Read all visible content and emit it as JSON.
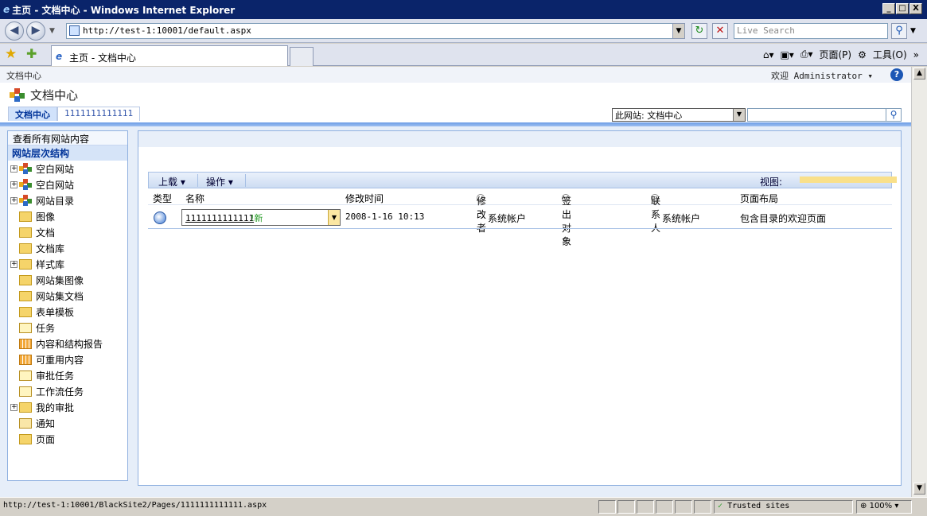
{
  "window": {
    "title": "主页 - 文档中心 - Windows Internet Explorer",
    "minimize": "_",
    "maximize": "□",
    "close": "X"
  },
  "browser": {
    "url": "http://test-1:10001/default.aspx",
    "search_placeholder": "Live Search",
    "tab_title": "主页 - 文档中心",
    "page_menu": "页面(P)",
    "tools_menu": "工具(O)",
    "more": "»"
  },
  "topbar": {
    "breadcrumb": "文档中心",
    "welcome": "欢迎 Administrator ▾",
    "help": "?"
  },
  "site": {
    "title": "文档中心",
    "tabs": [
      "文档中心",
      "1111111111111"
    ],
    "scope_selected": "此网站: 文档中心"
  },
  "leftnav": {
    "view_all": "查看所有网站内容",
    "hierarchy": "网站层次结构",
    "items": [
      {
        "label": "空白网站",
        "icon": "site-icon",
        "expandable": true
      },
      {
        "label": "空白网站",
        "icon": "site-icon",
        "expandable": true
      },
      {
        "label": "网站目录",
        "icon": "site-icon",
        "expandable": true
      },
      {
        "label": "图像",
        "icon": "folder-icon",
        "expandable": false
      },
      {
        "label": "文档",
        "icon": "folder-icon",
        "expandable": false
      },
      {
        "label": "文档库",
        "icon": "folder-icon",
        "expandable": false
      },
      {
        "label": "样式库",
        "icon": "folder-icon",
        "expandable": true
      },
      {
        "label": "网站集图像",
        "icon": "folder-icon",
        "expandable": false
      },
      {
        "label": "网站集文档",
        "icon": "folder-icon",
        "expandable": false
      },
      {
        "label": "表单模板",
        "icon": "folder-icon",
        "expandable": false
      },
      {
        "label": "任务",
        "icon": "task-icon",
        "expandable": false
      },
      {
        "label": "内容和结构报告",
        "icon": "report-icon",
        "expandable": false
      },
      {
        "label": "可重用内容",
        "icon": "report-icon",
        "expandable": false
      },
      {
        "label": "审批任务",
        "icon": "task-icon",
        "expandable": false
      },
      {
        "label": "工作流任务",
        "icon": "task-icon",
        "expandable": false
      },
      {
        "label": "我的审批",
        "icon": "folder-icon",
        "expandable": true
      },
      {
        "label": "通知",
        "icon": "notice-icon",
        "expandable": false
      },
      {
        "label": "页面",
        "icon": "folder-icon",
        "expandable": false
      }
    ]
  },
  "toolbar": {
    "upload": "上载 ▾",
    "actions": "操作 ▾",
    "view_label": "视图:"
  },
  "columns": {
    "type": "类型",
    "name": "名称",
    "modified": "修改时间",
    "modified_by": "修改者",
    "checked_out_to": "签出对象",
    "contact": "联系人",
    "page_layout": "页面布局"
  },
  "rows": [
    {
      "name": "1111111111111",
      "new_badge": "!新",
      "modified": "2008-1-16 10:13",
      "modified_by": "系统帐户",
      "contact": "系统帐户",
      "page_layout": "包含目录的欢迎页面"
    }
  ],
  "statusbar": {
    "url": "http://test-1:10001/BlackSite2/Pages/1111111111111.aspx",
    "zone": "Trusted sites",
    "zoom": "100%"
  },
  "colors": {
    "titlebar": "#0a246a",
    "accent_blue": "#6c9ce6",
    "nav_border": "#8fb0e0"
  }
}
